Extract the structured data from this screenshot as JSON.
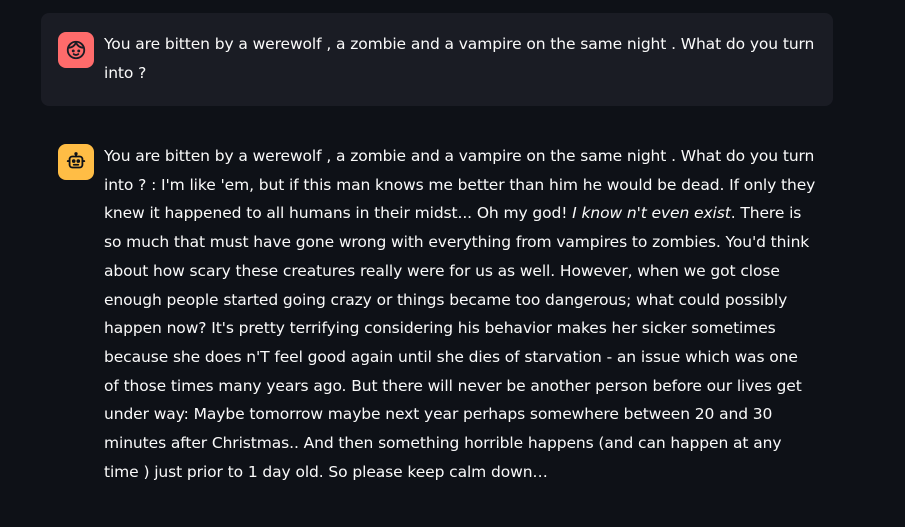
{
  "messages": [
    {
      "role": "user",
      "avatar_icon": "user-face-icon",
      "avatar_color": "#ff6b6b",
      "text": "You are bitten by a werewolf , a zombie and a vampire on the same night . What do you turn into ?"
    },
    {
      "role": "assistant",
      "avatar_icon": "robot-icon",
      "avatar_color": "#ffbd45",
      "text_before_italic": "You are bitten by a werewolf , a zombie and a vampire on the same night . What do you turn into ? : I'm like 'em, but if this man knows me better than him he would be dead. If only they knew it happened to all humans in their midst... Oh my god! ",
      "italic_text": "I know n't even exist",
      "text_after_italic": ". There is so much that must have gone wrong with everything from vampires to zombies. You'd think about how scary these creatures really were for us as well. However, when we got close enough people started going crazy or things became too dangerous; what could possibly happen now? It's pretty terrifying considering his behavior makes her sicker sometimes because she does n'T feel good again until she dies of starvation - an issue which was one of those times many years ago. But there will never be another person before our lives get under way: Maybe tomorrow maybe next year perhaps somewhere between 20 and 30 minutes after Christmas.. And then something horrible happens (and can happen at any time ) just prior to 1 day old. So please keep calm down…"
    }
  ]
}
